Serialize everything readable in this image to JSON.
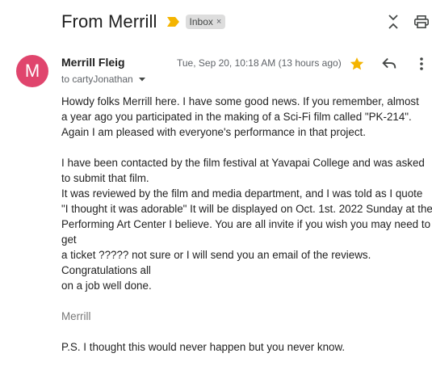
{
  "header": {
    "subject": "From Merrill",
    "label": "Inbox",
    "label_remove": "×"
  },
  "icons": {
    "importance": "importance-marker-icon",
    "collapse": "collapse-all-icon",
    "print": "print-icon",
    "star": "star-icon",
    "reply": "reply-icon",
    "more": "more-vert-icon",
    "details": "chevron-down-icon"
  },
  "colors": {
    "avatar": "#e0456d",
    "importance": "#f4b400",
    "star": "#f4b400",
    "chip": "#dddddd"
  },
  "message": {
    "avatar_letter": "M",
    "sender": "Merrill Fleig",
    "timestamp": "Tue, Sep 20, 10:18 AM (13 hours ago)",
    "recipients": "to cartyJonathan",
    "starred": true,
    "body": [
      "Howdy folks Merrill here. I have some good news. If you remember, almost",
      "a year ago you participated in the making of a Sci-Fi film called \"PK-214\".",
      "Again I am pleased with everyone's performance in that project.",
      "",
      "I have been contacted by the film festival at Yavapai College and was asked",
      "to submit that film.",
      "It was reviewed by the film and media department, and I was told as I quote",
      "\"I thought it was adorable\" It will be displayed on Oct. 1st. 2022 Sunday at the",
      "Performing Art Center I believe. You are all invite if you wish you may need to",
      "get",
      "a ticket ????? not sure or I will send you an email of the reviews.",
      "Congratulations all",
      "on a job well done.",
      "",
      "Merrill",
      "",
      "P.S. I thought this would never happen but you never know."
    ]
  }
}
